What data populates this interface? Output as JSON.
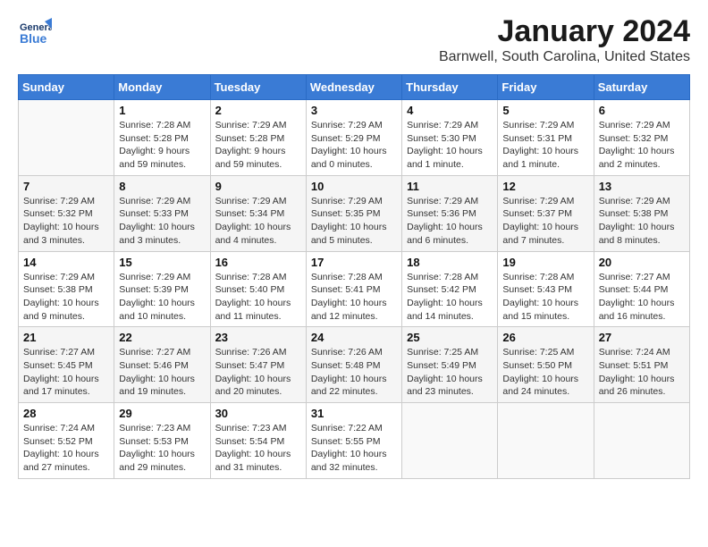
{
  "header": {
    "logo_general": "General",
    "logo_blue": "Blue",
    "month_title": "January 2024",
    "location": "Barnwell, South Carolina, United States"
  },
  "columns": [
    "Sunday",
    "Monday",
    "Tuesday",
    "Wednesday",
    "Thursday",
    "Friday",
    "Saturday"
  ],
  "weeks": [
    [
      {
        "day": "",
        "info": ""
      },
      {
        "day": "1",
        "info": "Sunrise: 7:28 AM\nSunset: 5:28 PM\nDaylight: 9 hours\nand 59 minutes."
      },
      {
        "day": "2",
        "info": "Sunrise: 7:29 AM\nSunset: 5:28 PM\nDaylight: 9 hours\nand 59 minutes."
      },
      {
        "day": "3",
        "info": "Sunrise: 7:29 AM\nSunset: 5:29 PM\nDaylight: 10 hours\nand 0 minutes."
      },
      {
        "day": "4",
        "info": "Sunrise: 7:29 AM\nSunset: 5:30 PM\nDaylight: 10 hours\nand 1 minute."
      },
      {
        "day": "5",
        "info": "Sunrise: 7:29 AM\nSunset: 5:31 PM\nDaylight: 10 hours\nand 1 minute."
      },
      {
        "day": "6",
        "info": "Sunrise: 7:29 AM\nSunset: 5:32 PM\nDaylight: 10 hours\nand 2 minutes."
      }
    ],
    [
      {
        "day": "7",
        "info": "Sunrise: 7:29 AM\nSunset: 5:32 PM\nDaylight: 10 hours\nand 3 minutes."
      },
      {
        "day": "8",
        "info": "Sunrise: 7:29 AM\nSunset: 5:33 PM\nDaylight: 10 hours\nand 3 minutes."
      },
      {
        "day": "9",
        "info": "Sunrise: 7:29 AM\nSunset: 5:34 PM\nDaylight: 10 hours\nand 4 minutes."
      },
      {
        "day": "10",
        "info": "Sunrise: 7:29 AM\nSunset: 5:35 PM\nDaylight: 10 hours\nand 5 minutes."
      },
      {
        "day": "11",
        "info": "Sunrise: 7:29 AM\nSunset: 5:36 PM\nDaylight: 10 hours\nand 6 minutes."
      },
      {
        "day": "12",
        "info": "Sunrise: 7:29 AM\nSunset: 5:37 PM\nDaylight: 10 hours\nand 7 minutes."
      },
      {
        "day": "13",
        "info": "Sunrise: 7:29 AM\nSunset: 5:38 PM\nDaylight: 10 hours\nand 8 minutes."
      }
    ],
    [
      {
        "day": "14",
        "info": "Sunrise: 7:29 AM\nSunset: 5:38 PM\nDaylight: 10 hours\nand 9 minutes."
      },
      {
        "day": "15",
        "info": "Sunrise: 7:29 AM\nSunset: 5:39 PM\nDaylight: 10 hours\nand 10 minutes."
      },
      {
        "day": "16",
        "info": "Sunrise: 7:28 AM\nSunset: 5:40 PM\nDaylight: 10 hours\nand 11 minutes."
      },
      {
        "day": "17",
        "info": "Sunrise: 7:28 AM\nSunset: 5:41 PM\nDaylight: 10 hours\nand 12 minutes."
      },
      {
        "day": "18",
        "info": "Sunrise: 7:28 AM\nSunset: 5:42 PM\nDaylight: 10 hours\nand 14 minutes."
      },
      {
        "day": "19",
        "info": "Sunrise: 7:28 AM\nSunset: 5:43 PM\nDaylight: 10 hours\nand 15 minutes."
      },
      {
        "day": "20",
        "info": "Sunrise: 7:27 AM\nSunset: 5:44 PM\nDaylight: 10 hours\nand 16 minutes."
      }
    ],
    [
      {
        "day": "21",
        "info": "Sunrise: 7:27 AM\nSunset: 5:45 PM\nDaylight: 10 hours\nand 17 minutes."
      },
      {
        "day": "22",
        "info": "Sunrise: 7:27 AM\nSunset: 5:46 PM\nDaylight: 10 hours\nand 19 minutes."
      },
      {
        "day": "23",
        "info": "Sunrise: 7:26 AM\nSunset: 5:47 PM\nDaylight: 10 hours\nand 20 minutes."
      },
      {
        "day": "24",
        "info": "Sunrise: 7:26 AM\nSunset: 5:48 PM\nDaylight: 10 hours\nand 22 minutes."
      },
      {
        "day": "25",
        "info": "Sunrise: 7:25 AM\nSunset: 5:49 PM\nDaylight: 10 hours\nand 23 minutes."
      },
      {
        "day": "26",
        "info": "Sunrise: 7:25 AM\nSunset: 5:50 PM\nDaylight: 10 hours\nand 24 minutes."
      },
      {
        "day": "27",
        "info": "Sunrise: 7:24 AM\nSunset: 5:51 PM\nDaylight: 10 hours\nand 26 minutes."
      }
    ],
    [
      {
        "day": "28",
        "info": "Sunrise: 7:24 AM\nSunset: 5:52 PM\nDaylight: 10 hours\nand 27 minutes."
      },
      {
        "day": "29",
        "info": "Sunrise: 7:23 AM\nSunset: 5:53 PM\nDaylight: 10 hours\nand 29 minutes."
      },
      {
        "day": "30",
        "info": "Sunrise: 7:23 AM\nSunset: 5:54 PM\nDaylight: 10 hours\nand 31 minutes."
      },
      {
        "day": "31",
        "info": "Sunrise: 7:22 AM\nSunset: 5:55 PM\nDaylight: 10 hours\nand 32 minutes."
      },
      {
        "day": "",
        "info": ""
      },
      {
        "day": "",
        "info": ""
      },
      {
        "day": "",
        "info": ""
      }
    ]
  ]
}
